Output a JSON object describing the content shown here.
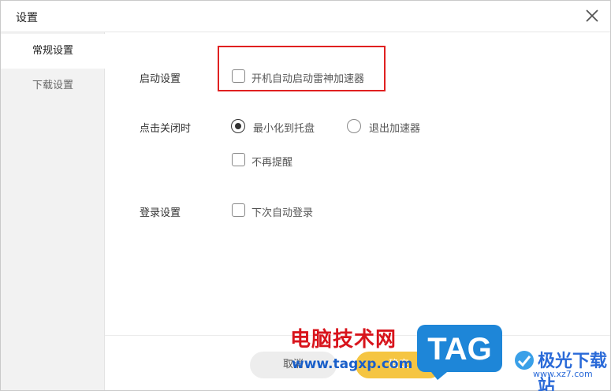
{
  "window": {
    "title": "设置"
  },
  "sidebar": {
    "items": [
      {
        "label": "常规设置",
        "active": true
      },
      {
        "label": "下载设置",
        "active": false
      }
    ]
  },
  "settings": {
    "startup": {
      "label": "启动设置",
      "option": {
        "label": "开机自动启动雷神加速器",
        "checked": false
      }
    },
    "close_click": {
      "label": "点击关闭时",
      "options": [
        {
          "label": "最小化到托盘",
          "checked": true
        },
        {
          "label": "退出加速器",
          "checked": false
        }
      ],
      "no_remind": {
        "label": "不再提醒",
        "checked": false
      }
    },
    "login": {
      "label": "登录设置",
      "option": {
        "label": "下次自动登录",
        "checked": false
      }
    }
  },
  "footer": {
    "cancel_label": "取消",
    "ok_label": "确定"
  },
  "watermark": {
    "site_cn": "电脑技术网",
    "site_url": "www.tagxp.com",
    "tag_text": "TAG",
    "right_site": "极光下载站",
    "right_url": "www.xz7.com"
  },
  "colors": {
    "highlight": "#e02020",
    "ok_button": "#f5c542",
    "sidebar_bg": "#f2f2f2"
  }
}
